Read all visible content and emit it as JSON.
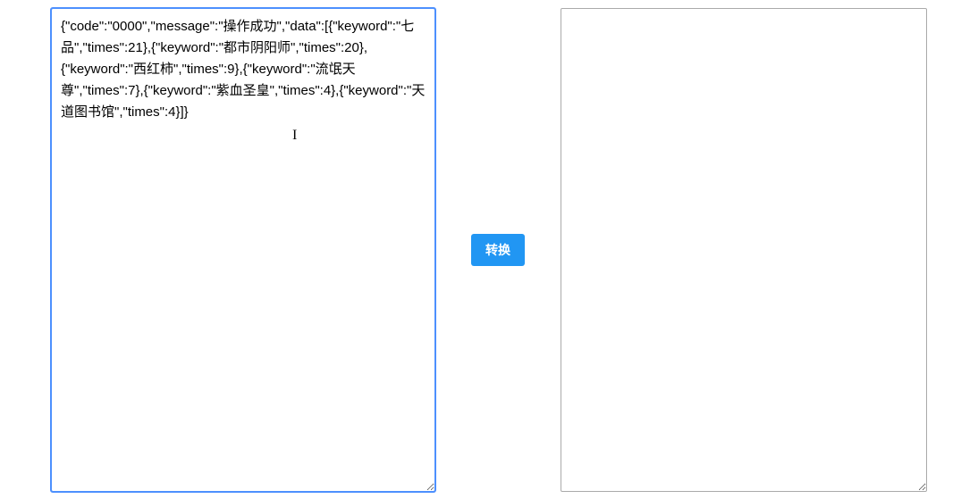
{
  "input": {
    "value": "{\"code\":\"0000\",\"message\":\"操作成功\",\"data\":[{\"keyword\":\"七品\",\"times\":21},{\"keyword\":\"都市阴阳师\",\"times\":20},{\"keyword\":\"西红柿\",\"times\":9},{\"keyword\":\"流氓天尊\",\"times\":7},{\"keyword\":\"紫血圣皇\",\"times\":4},{\"keyword\":\"天道图书馆\",\"times\":4}]}"
  },
  "output": {
    "value": ""
  },
  "button": {
    "convert_label": "转换"
  }
}
